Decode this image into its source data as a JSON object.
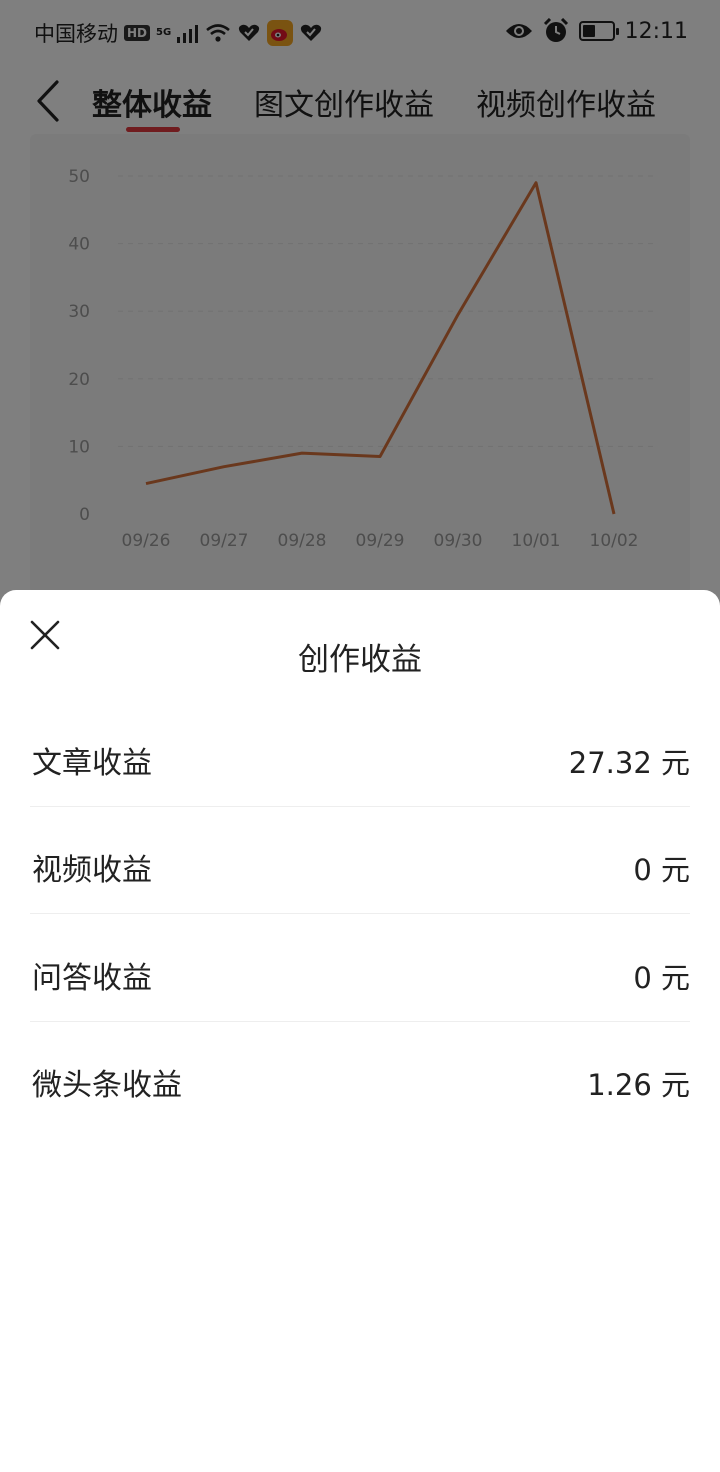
{
  "status_bar": {
    "carrier": "中国移动",
    "hd": "HD",
    "network": "5G",
    "time": "12:11",
    "battery_level": 0.45
  },
  "nav": {
    "tabs": [
      {
        "label": "整体收益",
        "active": true
      },
      {
        "label": "图文创作收益",
        "active": false
      },
      {
        "label": "视频创作收益",
        "active": false
      }
    ],
    "accent_color": "#e0393e"
  },
  "chart_data": {
    "type": "line",
    "x": [
      "09/26",
      "09/27",
      "09/28",
      "09/29",
      "09/30",
      "10/01",
      "10/02"
    ],
    "series": [
      {
        "values": [
          4.5,
          7,
          9,
          8.5,
          29.5,
          49,
          0
        ],
        "color": "#d4703a"
      }
    ],
    "y_ticks": [
      0,
      10,
      20,
      30,
      40,
      50
    ],
    "ylim": [
      0,
      50
    ],
    "grid": true
  },
  "sheet": {
    "title": "创作收益",
    "rows": [
      {
        "label": "文章收益",
        "value": "27.32 元"
      },
      {
        "label": "视频收益",
        "value": "0 元"
      },
      {
        "label": "问答收益",
        "value": "0 元"
      },
      {
        "label": "微头条收益",
        "value": "1.26 元"
      }
    ]
  },
  "icons": {
    "back": "chevron-left-icon",
    "close": "close-icon",
    "eye": "eye-icon",
    "alarm": "alarm-icon",
    "wifi": "wifi-icon",
    "weibo": "weibo-icon"
  }
}
